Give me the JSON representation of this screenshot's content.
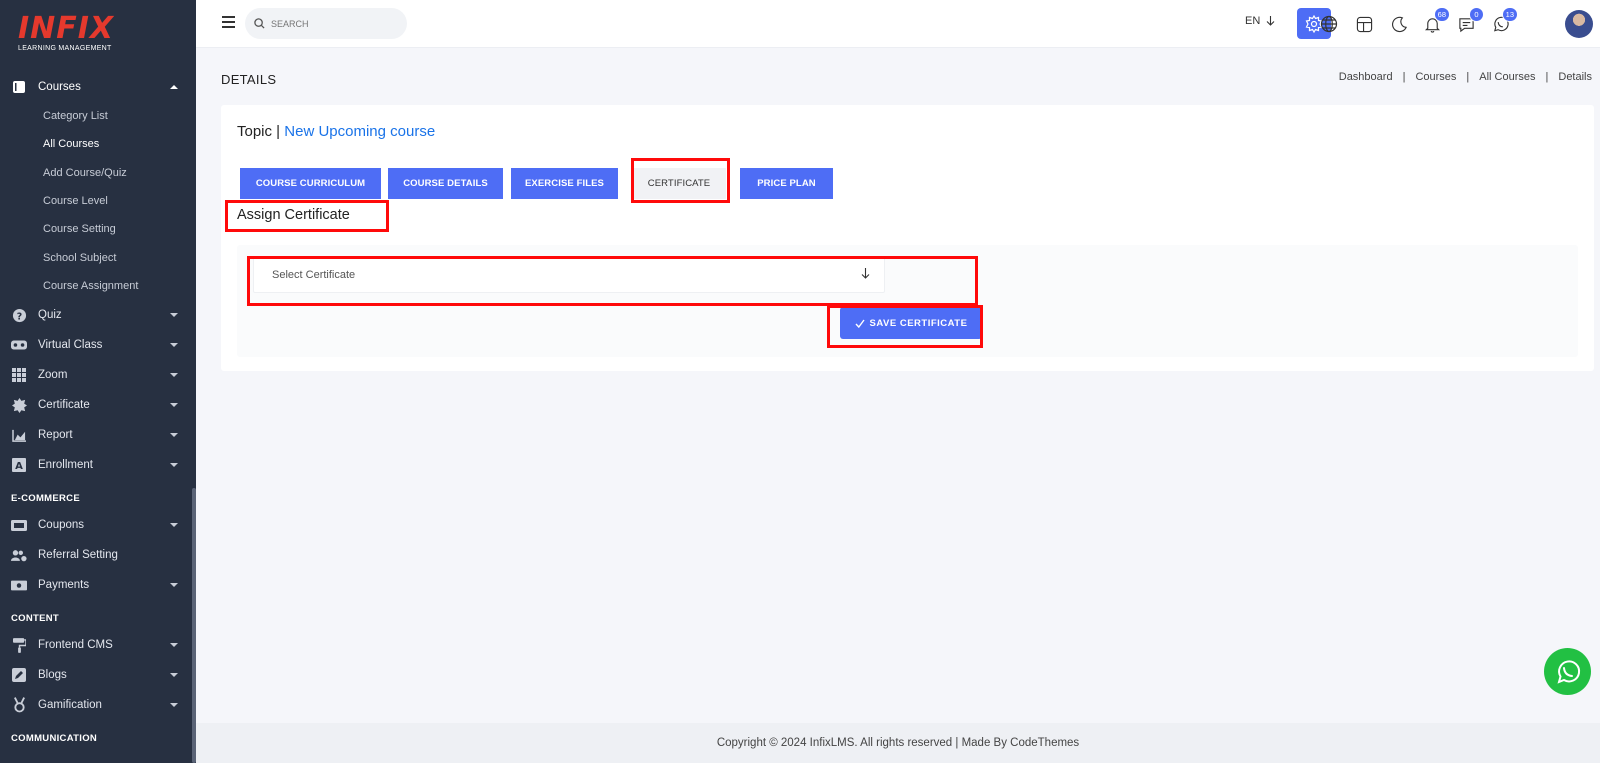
{
  "brand": {
    "name": "INFIX",
    "tagline": "LEARNING MANAGEMENT"
  },
  "sidebar": {
    "courses": {
      "label": "Courses",
      "items": [
        "Category List",
        "All Courses",
        "Add Course/Quiz",
        "Course Level",
        "Course Setting",
        "School Subject",
        "Course Assignment"
      ]
    },
    "menu": [
      {
        "label": "Quiz"
      },
      {
        "label": "Virtual Class"
      },
      {
        "label": "Zoom"
      },
      {
        "label": "Certificate"
      },
      {
        "label": "Report"
      },
      {
        "label": "Enrollment"
      }
    ],
    "sections": {
      "ecommerce": "E-COMMERCE",
      "content": "CONTENT",
      "communication": "COMMUNICATION"
    },
    "ecommerce_items": [
      "Coupons",
      "Referral Setting",
      "Payments"
    ],
    "content_items": [
      "Frontend CMS",
      "Blogs",
      "Gamification"
    ]
  },
  "topbar": {
    "search_placeholder": "SEARCH",
    "language": "EN",
    "badges": {
      "notifications": "68",
      "messages": "0",
      "chat": "13"
    }
  },
  "page": {
    "title": "DETAILS",
    "breadcrumb": [
      "Dashboard",
      "Courses",
      "All Courses",
      "Details"
    ],
    "topic_label": "Topic |",
    "topic_name": "New Upcoming course"
  },
  "tabs": [
    "COURSE CURRICULUM",
    "COURSE DETAILS",
    "EXERCISE FILES",
    "CERTIFICATE",
    "PRICE PLAN"
  ],
  "certificate": {
    "heading": "Assign Certificate",
    "select_placeholder": "Select Certificate",
    "save_label": "SAVE CERTIFICATE"
  },
  "footer": "Copyright © 2024 InfixLMS. All rights reserved | Made By CodeThemes",
  "colors": {
    "sidebar_bg": "#273041",
    "accent": "#4e6df5",
    "highlight": "#ff0a0a",
    "whatsapp": "#22c043"
  }
}
